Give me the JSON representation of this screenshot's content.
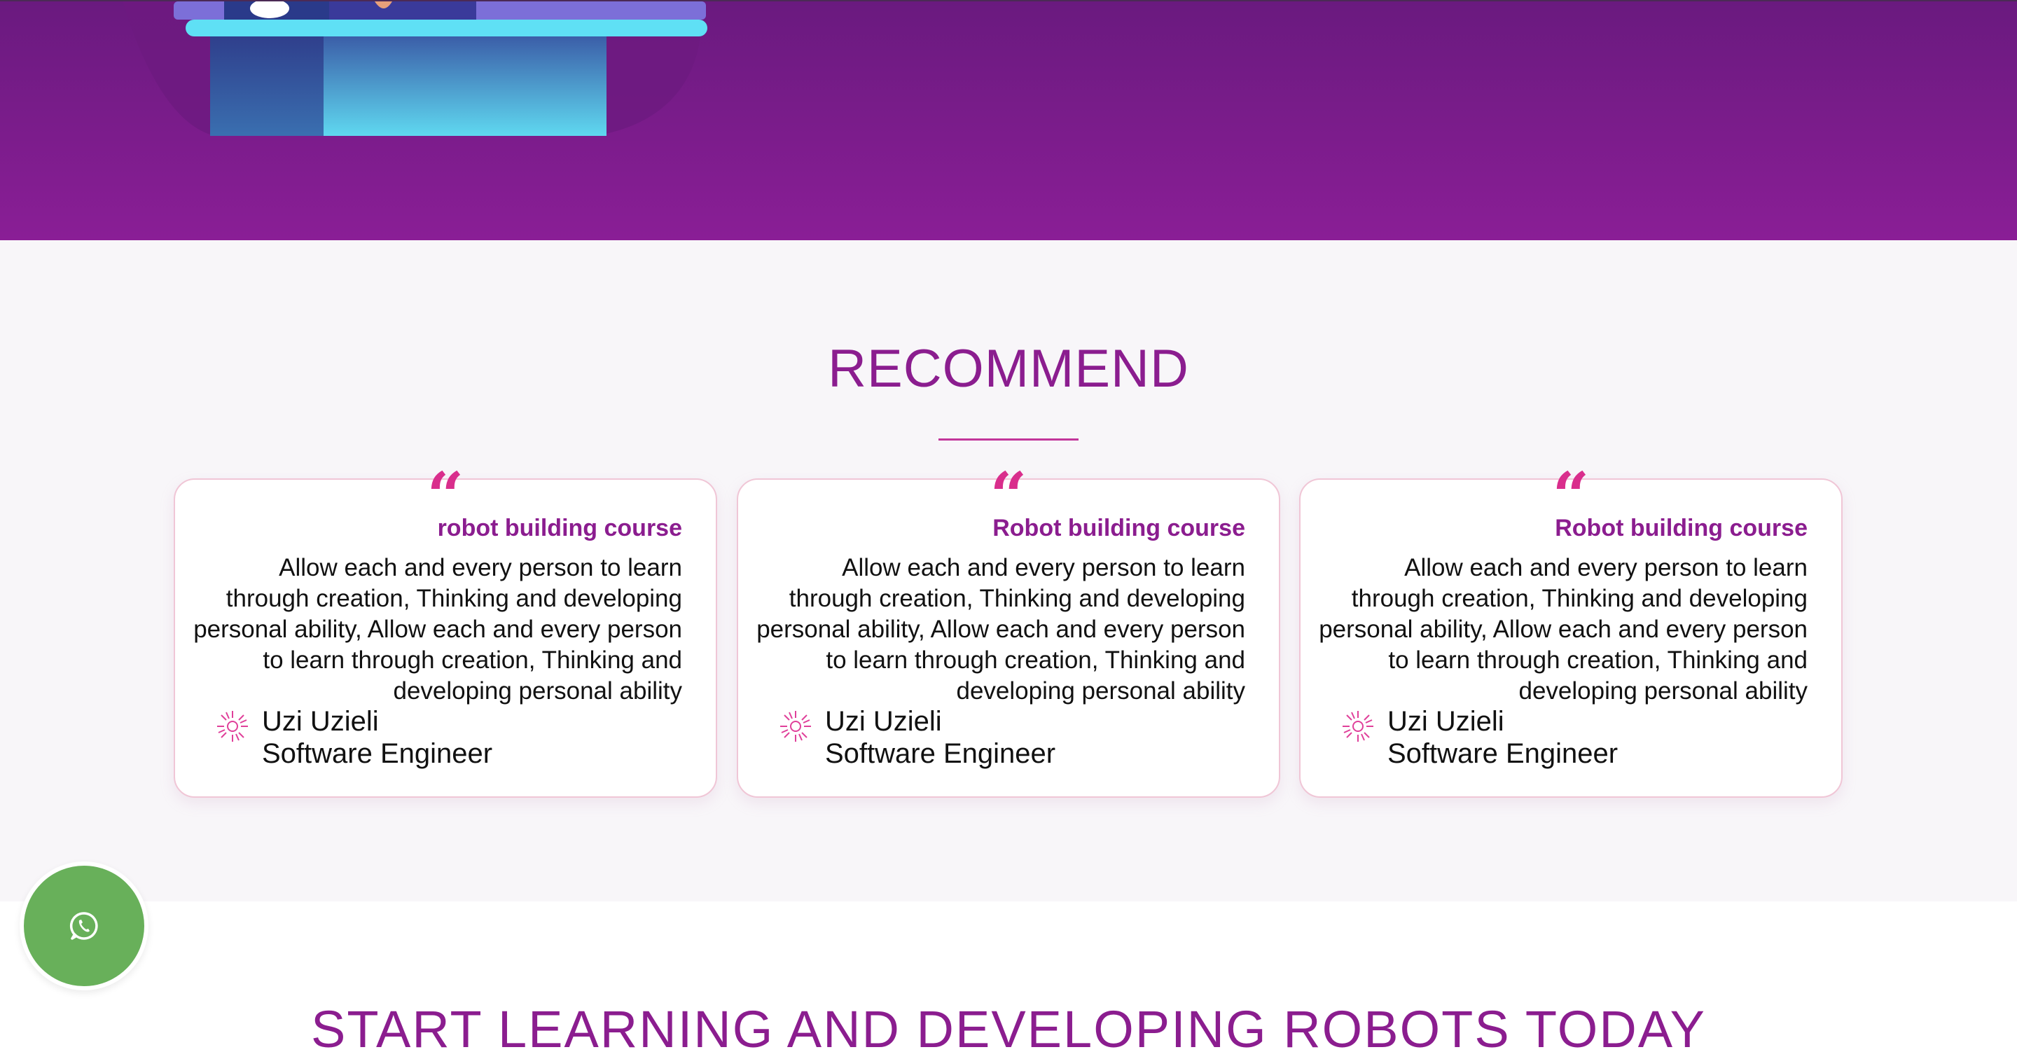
{
  "colors": {
    "brand_purple": "#8b1d8f",
    "accent_pink": "#d92e8c",
    "whatsapp_green": "#68b05a"
  },
  "recommend": {
    "title": "RECOMMEND",
    "cards": [
      {
        "quote_mark": "“",
        "title": "robot building course",
        "body": "Allow each and every person to learn through creation, Thinking and developing personal ability, Allow each and every person to learn through creation, Thinking and developing personal ability",
        "author_name": "Uzi Uzieli",
        "author_role": "Software Engineer",
        "author_icon": "sparkle-burst-icon"
      },
      {
        "quote_mark": "“",
        "title": "Robot building course",
        "body": "Allow each and every person to learn through creation, Thinking and developing personal ability, Allow each and every person to learn through creation, Thinking and developing personal ability",
        "author_name": "Uzi Uzieli",
        "author_role": "Software Engineer",
        "author_icon": "sparkle-burst-icon"
      },
      {
        "quote_mark": "“",
        "title": "Robot building course",
        "body": "Allow each and every person to learn through creation, Thinking and developing personal ability, Allow each and every person to learn through creation, Thinking and developing personal ability",
        "author_name": "Uzi Uzieli",
        "author_role": "Software Engineer",
        "author_icon": "sparkle-burst-icon"
      }
    ]
  },
  "cta": {
    "title": "START LEARNING AND DEVELOPING ROBOTS TODAY"
  },
  "whatsapp": {
    "icon": "whatsapp-icon"
  }
}
